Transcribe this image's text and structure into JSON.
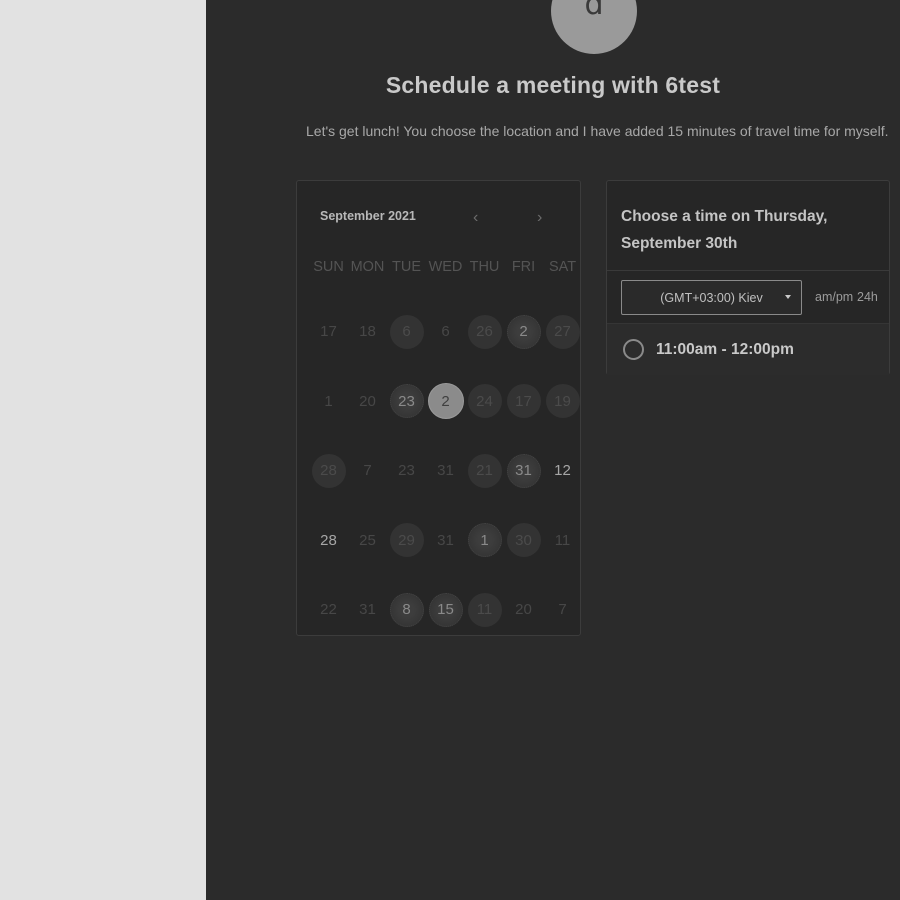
{
  "header": {
    "avatar_letter": "d",
    "title": "Schedule a meeting with 6test",
    "subtitle": "Let's get lunch! You choose the location and I have added 15 minutes of travel time for myself."
  },
  "calendar": {
    "month_label": "September 2021",
    "prev_icon": "chevron-left-icon",
    "next_icon": "chevron-right-icon",
    "weekdays": [
      "SUN",
      "MON",
      "TUE",
      "WED",
      "THU",
      "FRI",
      "SAT"
    ],
    "weeks": [
      [
        "17",
        "18",
        "6",
        "6",
        "26",
        "2",
        "27"
      ],
      [
        "1",
        "20",
        "23",
        "2",
        "24",
        "17",
        "19"
      ],
      [
        "28",
        "7",
        "23",
        "31",
        "21",
        "31",
        "12"
      ],
      [
        "28",
        "25",
        "29",
        "31",
        "1",
        "30",
        "11"
      ],
      [
        "22",
        "31",
        "8",
        "15",
        "11",
        "20",
        "7"
      ]
    ],
    "selected_day": "2"
  },
  "times": {
    "heading": "Choose a time on Thursday, September 30th",
    "timezone": "(GMT+03:00) Kiev",
    "format_ampm": "am/pm",
    "format_24h": "24h",
    "slots": [
      "11:00am - 12:00pm"
    ]
  },
  "colors": {
    "background": "#2b2b2b",
    "side_panel": "#e2e2e2",
    "selected_day": "#8b8b8b"
  }
}
